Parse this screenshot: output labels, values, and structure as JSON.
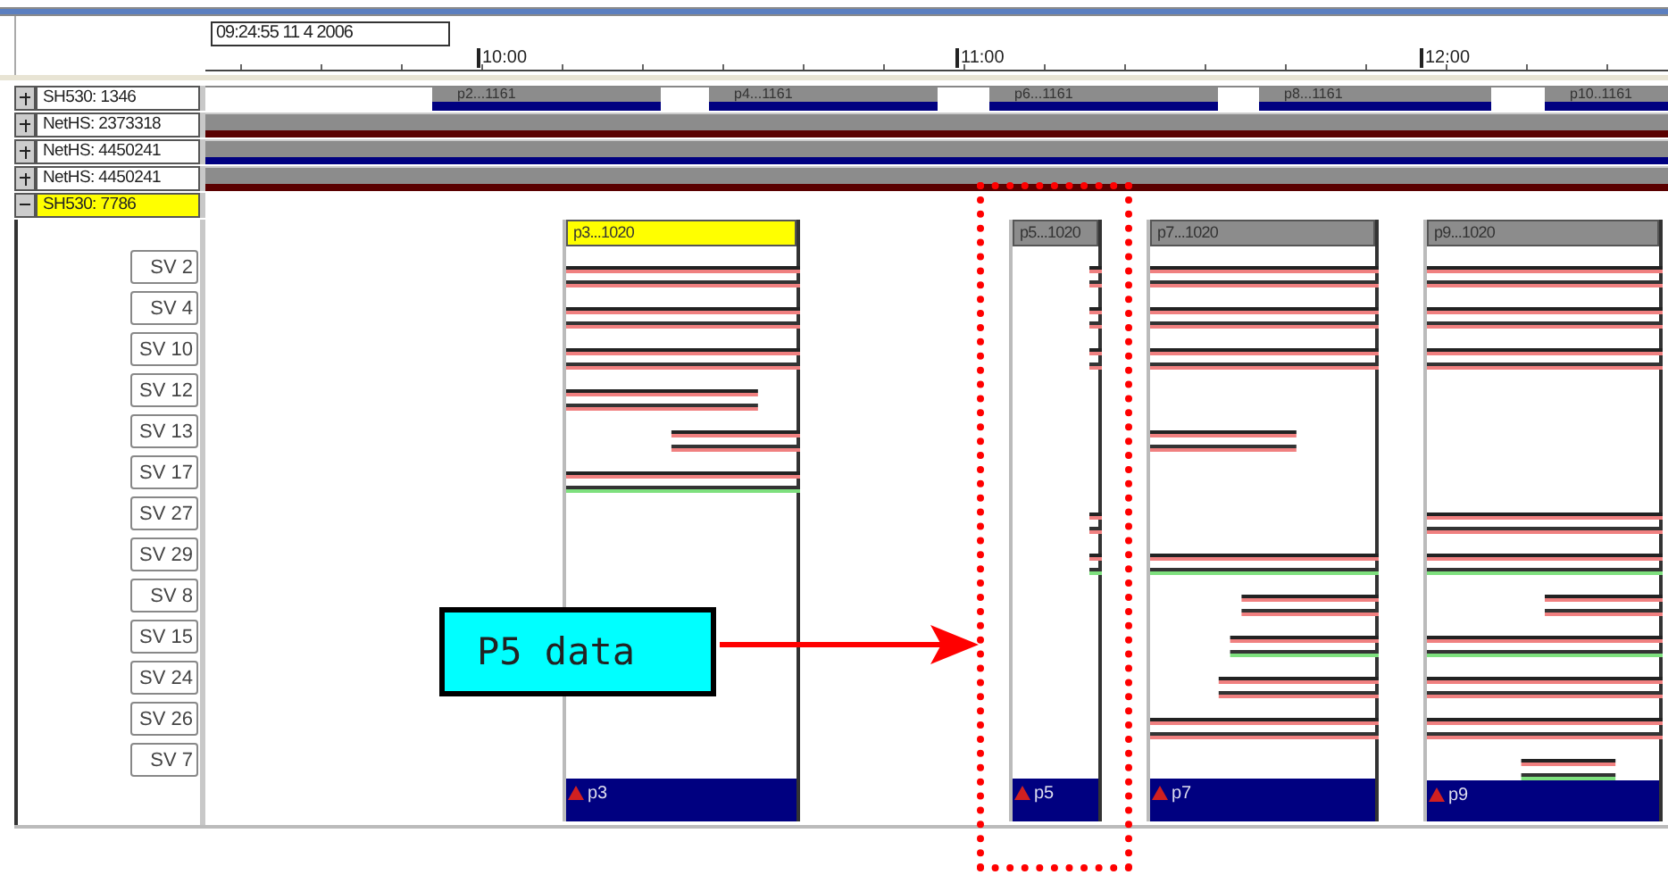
{
  "timestamp": "09:24:55 11 4 2006",
  "ruler": {
    "ticks": [
      "10:00",
      "11:00",
      "12:00"
    ]
  },
  "groups": [
    {
      "label": "SH530: 1346",
      "expanded": false,
      "selected": false,
      "color": "#000080",
      "segments": [
        "p2...1161",
        "p4...1161",
        "p6...1161",
        "p8...1161",
        "p10..1161"
      ]
    },
    {
      "label": "NetHS: 2373318",
      "expanded": false,
      "selected": false,
      "color": "#5a0000"
    },
    {
      "label": "NetHS: 4450241",
      "expanded": false,
      "selected": false,
      "color": "#000080"
    },
    {
      "label": "NetHS: 4450241",
      "expanded": false,
      "selected": false,
      "color": "#5a0000"
    },
    {
      "label": "SH530: 7786",
      "expanded": true,
      "selected": true
    }
  ],
  "channels": [
    "SV 2",
    "SV 4",
    "SV 10",
    "SV 12",
    "SV 13",
    "SV 17",
    "SV 27",
    "SV 29",
    "SV 8",
    "SV 15",
    "SV 24",
    "SV 26",
    "SV 7"
  ],
  "panels": [
    {
      "title": "p3...1020",
      "footer": "p3",
      "selected": true
    },
    {
      "title": "p5...1020",
      "footer": "p5",
      "selected": false
    },
    {
      "title": "p7...1020",
      "footer": "p7",
      "selected": false
    },
    {
      "title": "p9...1020",
      "footer": "p9",
      "selected": false
    }
  ],
  "callout": {
    "text": "P5 data"
  }
}
